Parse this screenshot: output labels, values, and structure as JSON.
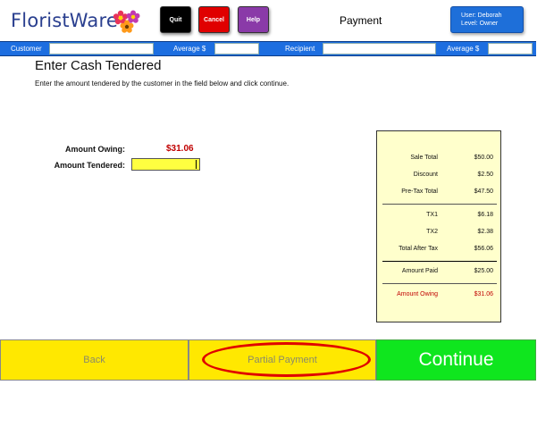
{
  "header": {
    "logo_text": "FloristWare",
    "quit_label": "Quit",
    "cancel_label": "Cancel",
    "help_label": "Help",
    "title": "Payment",
    "user_line": "User: Deborah",
    "level_line": "Level: Owner"
  },
  "infobar": {
    "customer_label": "Customer",
    "customer_value": "",
    "average1_label": "Average $",
    "average1_value": "",
    "recipient_label": "Recipient",
    "recipient_value": "",
    "average2_label": "Average $",
    "average2_value": ""
  },
  "main": {
    "title": "Enter Cash Tendered",
    "instruction": "Enter the amount tendered by the customer in the field below and click continue.",
    "amount_owing_label": "Amount Owing:",
    "amount_owing_value": "$31.06",
    "amount_tendered_label": "Amount Tendered:",
    "amount_tendered_value": ""
  },
  "summary": {
    "rows": [
      {
        "label": "Sale Total",
        "value": "$50.00"
      },
      {
        "label": "Discount",
        "value": "$2.50"
      },
      {
        "label": "Pre-Tax Total",
        "value": "$47.50"
      },
      {
        "label": "TX1",
        "value": "$6.18"
      },
      {
        "label": "TX2",
        "value": "$2.38"
      },
      {
        "label": "Total After Tax",
        "value": "$56.06"
      },
      {
        "label": "Amount Paid",
        "value": "$25.00"
      },
      {
        "label": "Amount Owing",
        "value": "$31.06"
      }
    ]
  },
  "footer": {
    "back_label": "Back",
    "partial_label": "Partial Payment",
    "continue_label": "Continue"
  },
  "colors": {
    "brand_blue": "#1d6ee0",
    "owing_red": "#c00000",
    "button_yellow": "#ffe800",
    "continue_green": "#0fe61e",
    "summary_bg": "#ffffcc"
  }
}
